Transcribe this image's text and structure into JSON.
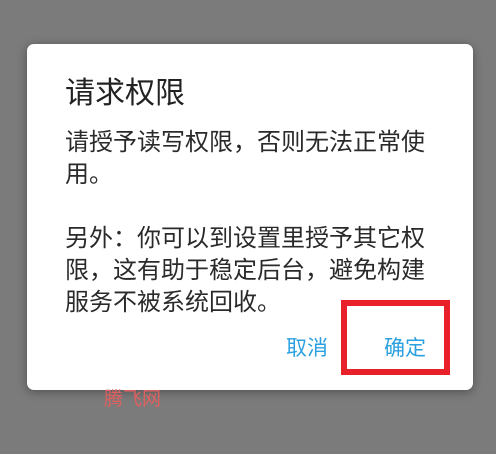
{
  "dialog": {
    "title": "请求权限",
    "message_line1": "请授予读写权限，否则无法正常使",
    "message_line2": "用。",
    "message_line3": "另外：你可以到设置里授予其它权",
    "message_line4": "限，这有助于稳定后台，避免构建",
    "message_line5": "服务不被系统回收。",
    "cancel_label": "取消",
    "confirm_label": "确定"
  },
  "annotation": {
    "color": "#e8202a"
  },
  "watermark": {
    "text": "腾飞网"
  },
  "colors": {
    "overlay": "#7b7b7b",
    "dialog_bg": "#ffffff",
    "button_text": "#2ba0e0"
  }
}
